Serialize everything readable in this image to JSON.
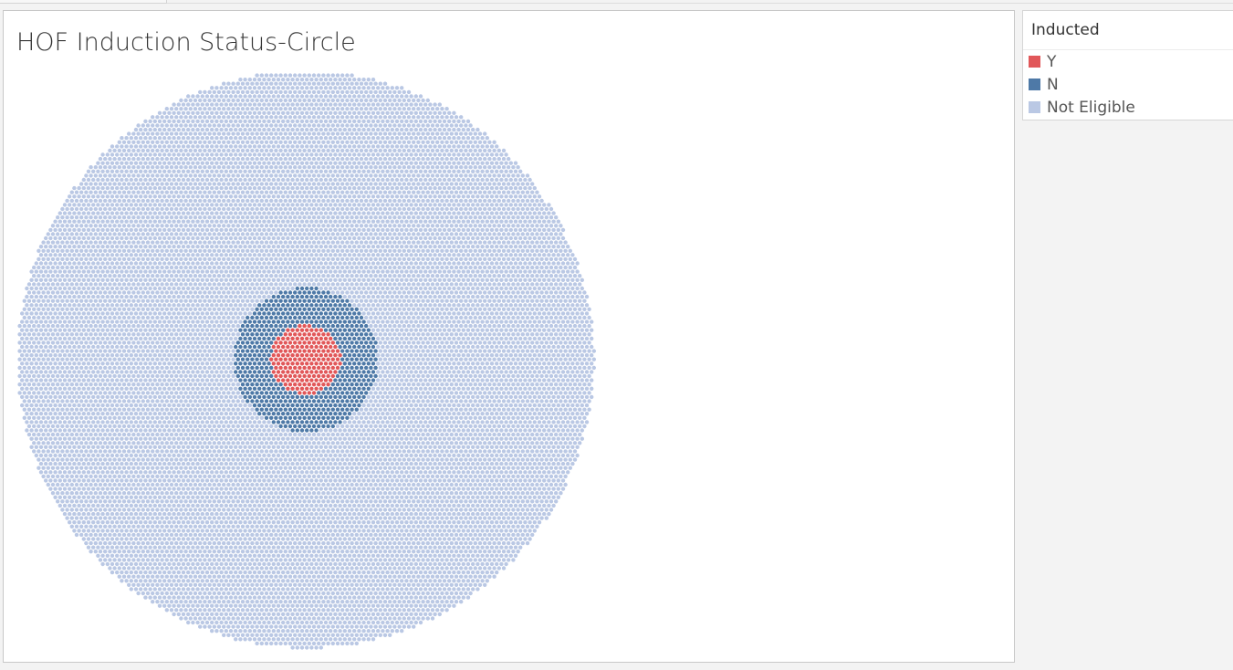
{
  "chart_data": {
    "type": "scatter",
    "title": "HOF Induction Status-Circle",
    "legend_title": "Inducted",
    "legend_position": "top-right",
    "grid": false,
    "series": [
      {
        "name": "Y",
        "color": "#e15759",
        "ring": "inner",
        "outer_radius_fraction": 0.12
      },
      {
        "name": "N",
        "color": "#4e79a7",
        "ring": "middle",
        "outer_radius_fraction": 0.25
      },
      {
        "name": "Not Eligible",
        "color": "#bac8e4",
        "ring": "outer",
        "outer_radius_fraction": 1.0
      }
    ]
  },
  "legend": {
    "title": "Inducted",
    "items": [
      {
        "label": "Y",
        "color": "#e15759"
      },
      {
        "label": "N",
        "color": "#4e79a7"
      },
      {
        "label": "Not Eligible",
        "color": "#bac8e4"
      }
    ]
  }
}
